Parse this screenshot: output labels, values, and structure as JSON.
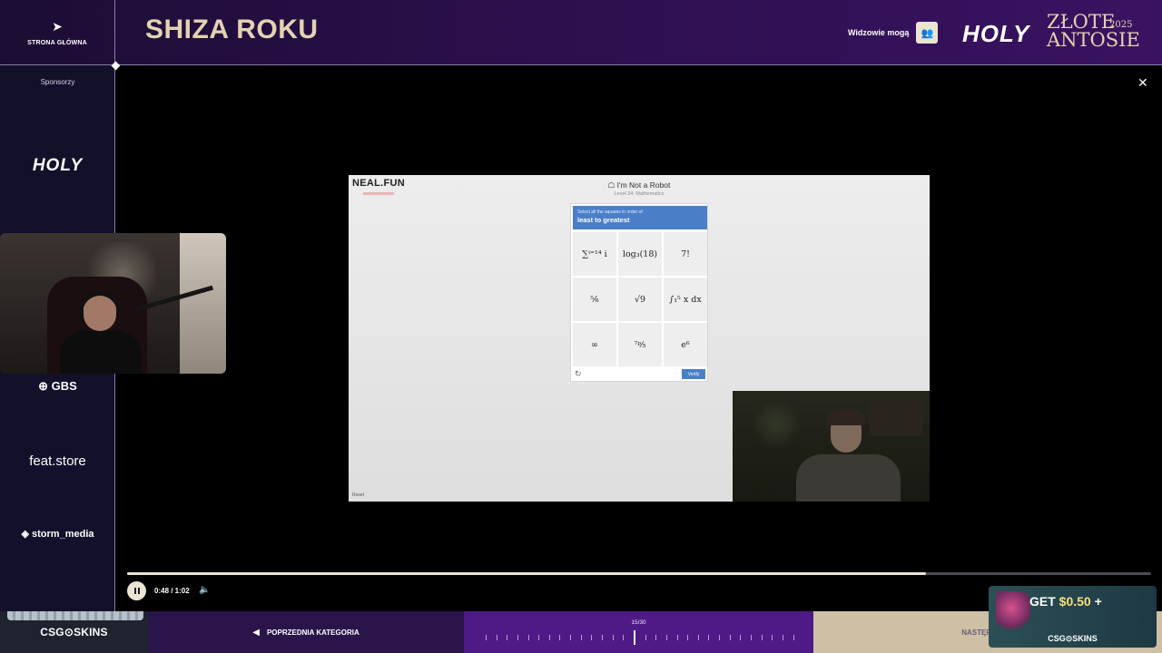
{
  "header": {
    "home_label": "STRONA GŁÓWNA",
    "title": "SHIZA ROKU",
    "viewers_label": "Widzowie mogą",
    "brand_holy": "HOLY",
    "brand_zlote": "ZŁOTE",
    "brand_antosie": "ANTOSIE",
    "brand_year": "2025"
  },
  "sidebar": {
    "sponsors_label": "Sponsorzy",
    "sponsors": [
      "HOLY",
      "GBS",
      "feat.store",
      "storm_media"
    ]
  },
  "video": {
    "site_logo": "NEAL.FUN",
    "game_title": "I'm Not a Robot",
    "game_level": "Level 34: Mathematics",
    "instruction_small": "Select all the squares in order of",
    "instruction_bold": "least to greatest",
    "cells": [
      "∑ⁱ⁼¹⁴ i",
      "log₃(18)",
      "7!",
      "⁵⁄₆",
      "√9",
      "∫₁⁵ x dx",
      "∞",
      "⁷ᵖ⁄₅",
      "e⁶"
    ],
    "verify_label": "Verify",
    "pixel_note": "Reset"
  },
  "player": {
    "progress_fraction": 0.78,
    "time": "0:48 / 1:02"
  },
  "bottom": {
    "csg_label": "CSG⊙SKINS",
    "prev_label": "POPRZEDNIA KATEGORIA",
    "counter": "15/30",
    "next_label": "NASTĘPNA KA"
  },
  "ad": {
    "get_label": "GET",
    "amount": "$0.50",
    "plus": "+",
    "brand": "CSG⊙SKINS"
  },
  "colors": {
    "accent_gold": "#e3d3b2",
    "header_purple": "#2a0f4a",
    "bottom_purple": "#4e1a86",
    "captcha_blue": "#4a7ec8"
  }
}
